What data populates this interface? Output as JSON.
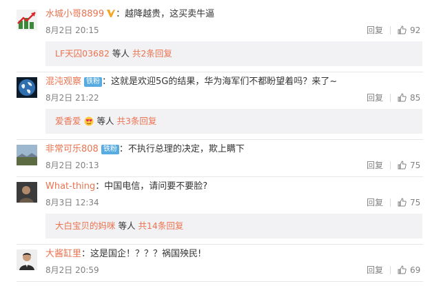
{
  "comments": [
    {
      "username": "水城小哥8899",
      "verified": "V",
      "fan_badge": "",
      "text": "：越降越贵，这买卖牛逼",
      "time": "8月2日 20:15",
      "reply_label": "回复",
      "likes": "92",
      "sub_reply": {
        "user": "LF天囚03682",
        "mid": " 等人 ",
        "count": "共2条回复"
      }
    },
    {
      "username": "混沌观察",
      "verified": "",
      "fan_badge": "铁粉",
      "text": "：这就是欢迎5G的结果，华为海军们不都盼望着吗？来了~",
      "time": "8月2日 21:22",
      "reply_label": "回复",
      "likes": "85",
      "sub_reply": {
        "user": "爱香爱",
        "mid": " 等人 ",
        "count": "共3条回复"
      }
    },
    {
      "username": "非常可乐808",
      "verified": "",
      "fan_badge": "铁粉",
      "text": "：不执行总理的决定，欺上瞒下",
      "time": "8月2日 20:13",
      "reply_label": "回复",
      "likes": "75",
      "sub_reply": null
    },
    {
      "username": "What-thing",
      "verified": "",
      "fan_badge": "",
      "text": "：中国电信，请问要不要脸?",
      "time": "8月3日 12:34",
      "reply_label": "回复",
      "likes": "75",
      "sub_reply": {
        "user": "大白宝贝的妈咪",
        "mid": " 等人 ",
        "count": "共14条回复"
      }
    },
    {
      "username": "大酱缸里",
      "verified": "",
      "fan_badge": "",
      "text": "：这是国企！？？？祸国殃民!",
      "time": "8月2日 20:59",
      "reply_label": "回复",
      "likes": "69",
      "sub_reply": null
    }
  ],
  "colors": {
    "username": "#eb7350",
    "text": "#333333",
    "meta": "#808080",
    "fan_badge": "#57abe0",
    "sub_reply_bg": "#f2f2f5"
  },
  "icons": {
    "like": "thumbs-up-icon",
    "verified": "verified-v-icon",
    "emoji": "heart-eyes-emoji-icon"
  }
}
